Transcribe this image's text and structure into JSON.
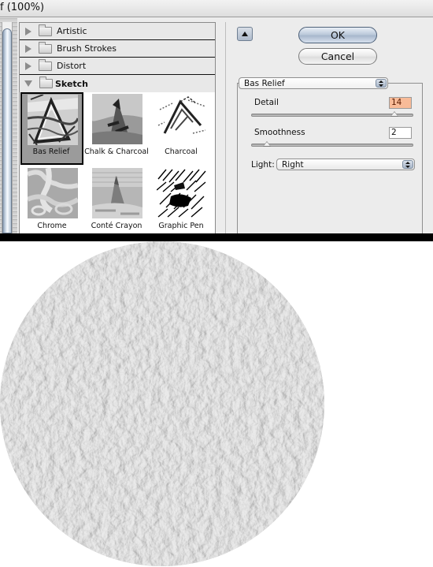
{
  "window": {
    "title": "f (100%)"
  },
  "filter_gallery": {
    "categories": [
      {
        "label": "Artistic",
        "expanded": false
      },
      {
        "label": "Brush Strokes",
        "expanded": false
      },
      {
        "label": "Distort",
        "expanded": false
      },
      {
        "label": "Sketch",
        "expanded": true
      }
    ],
    "thumbnails": [
      {
        "label": "Bas Relief",
        "selected": true,
        "icon": "bas-relief-thumbnail"
      },
      {
        "label": "Chalk & Charcoal",
        "selected": false,
        "icon": "chalk-charcoal-thumbnail"
      },
      {
        "label": "Charcoal",
        "selected": false,
        "icon": "charcoal-thumbnail"
      },
      {
        "label": "Chrome",
        "selected": false,
        "icon": "chrome-thumbnail"
      },
      {
        "label": "Conté Crayon",
        "selected": false,
        "icon": "conte-crayon-thumbnail"
      },
      {
        "label": "Graphic Pen",
        "selected": false,
        "icon": "graphic-pen-thumbnail"
      }
    ]
  },
  "actions": {
    "toggle_icon": "collapse-triangle-icon",
    "ok_label": "OK",
    "cancel_label": "Cancel"
  },
  "settings": {
    "filter_select": {
      "value": "Bas Relief"
    },
    "detail": {
      "label": "Detail",
      "value": "14",
      "min": 1,
      "max": 15,
      "highlight_color": "#f8bb98"
    },
    "smoothness": {
      "label": "Smoothness",
      "value": "2",
      "min": 1,
      "max": 15
    },
    "light": {
      "label": "Light:",
      "value": "Right"
    }
  },
  "colors": {
    "dialog_bg": "#ececec",
    "separator": "#000000",
    "texture_base": "#bdbdbd"
  }
}
